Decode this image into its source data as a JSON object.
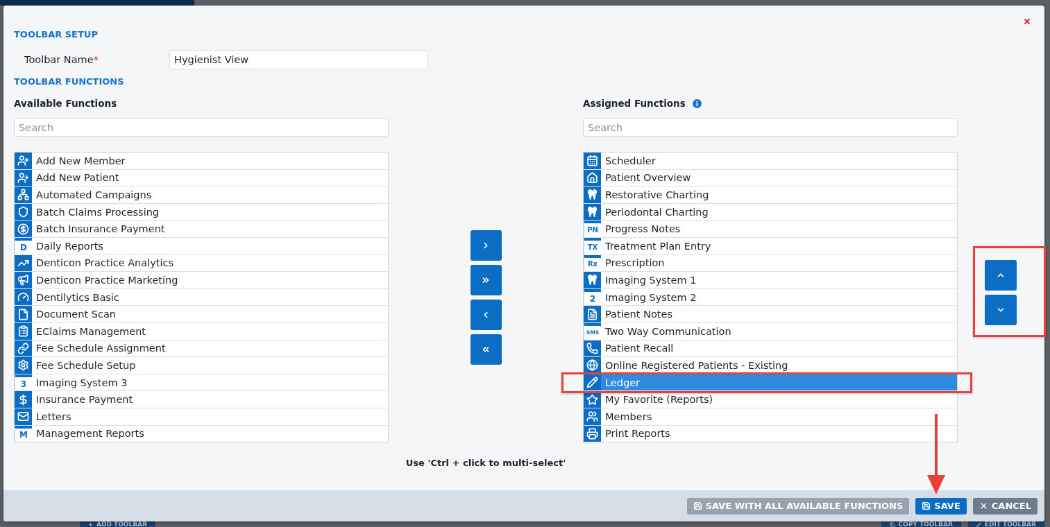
{
  "dialog": {
    "title": "TOOLBAR SETUP",
    "name_field": {
      "label": "Toolbar Name",
      "required_mark": "*",
      "value": "Hygienist View"
    },
    "functions_title": "TOOLBAR FUNCTIONS"
  },
  "available": {
    "title": "Available Functions",
    "search_placeholder": "Search",
    "items": [
      {
        "label": "Add New Member",
        "selected": false
      },
      {
        "label": "Add New Patient",
        "selected": false
      },
      {
        "label": "Automated Campaigns",
        "selected": false
      },
      {
        "label": "Batch Claims Processing",
        "selected": false
      },
      {
        "label": "Batch Insurance Payment",
        "selected": false
      },
      {
        "label": "Daily Reports",
        "icon_text": "D",
        "selected": false
      },
      {
        "label": "Denticon Practice Analytics",
        "selected": false
      },
      {
        "label": "Denticon Practice Marketing",
        "selected": false
      },
      {
        "label": "Dentilytics Basic",
        "selected": false
      },
      {
        "label": "Document Scan",
        "selected": false
      },
      {
        "label": "EClaims Management",
        "selected": false
      },
      {
        "label": "Fee Schedule Assignment",
        "selected": false
      },
      {
        "label": "Fee Schedule Setup",
        "selected": false
      },
      {
        "label": "Imaging System 3",
        "icon_text": "3",
        "selected": false
      },
      {
        "label": "Insurance Payment",
        "selected": false
      },
      {
        "label": "Letters",
        "selected": false
      },
      {
        "label": "Management Reports",
        "icon_text": "M",
        "selected": false
      }
    ]
  },
  "transfer_buttons": [
    {
      "kind": "add"
    },
    {
      "kind": "add_all"
    },
    {
      "kind": "remove"
    },
    {
      "kind": "remove_all"
    }
  ],
  "assigned": {
    "title": "Assigned Functions",
    "info": true,
    "search_placeholder": "Search",
    "items": [
      {
        "label": "Scheduler",
        "selected": false,
        "highlighted": false
      },
      {
        "label": "Patient Overview",
        "selected": false,
        "highlighted": false
      },
      {
        "label": "Restorative Charting",
        "selected": false,
        "highlighted": false
      },
      {
        "label": "Periodontal Charting",
        "selected": false,
        "highlighted": false
      },
      {
        "label": "Progress Notes",
        "icon_text": "PN",
        "selected": false,
        "highlighted": false
      },
      {
        "label": "Treatment Plan Entry",
        "icon_text": "TX",
        "selected": false,
        "highlighted": false
      },
      {
        "label": "Prescription",
        "icon_text": "Rx",
        "selected": false,
        "highlighted": false
      },
      {
        "label": "Imaging System 1",
        "selected": false,
        "highlighted": false
      },
      {
        "label": "Imaging System 2",
        "icon_text": "2",
        "selected": false,
        "highlighted": false
      },
      {
        "label": "Patient Notes",
        "selected": false,
        "highlighted": false
      },
      {
        "label": "Two Way Communication",
        "icon_text": "SMS",
        "selected": false,
        "highlighted": false
      },
      {
        "label": "Patient Recall",
        "selected": false,
        "highlighted": false
      },
      {
        "label": "Online Registered Patients - Existing",
        "selected": false,
        "highlighted": false
      },
      {
        "label": "Ledger",
        "selected": true,
        "highlighted": true
      },
      {
        "label": "My Favorite (Reports)",
        "selected": false,
        "highlighted": false
      },
      {
        "label": "Members",
        "selected": false,
        "highlighted": false
      },
      {
        "label": "Print Reports",
        "selected": false,
        "highlighted": false
      }
    ]
  },
  "order_buttons": {
    "highlighted": true,
    "buttons": [
      {
        "kind": "up"
      },
      {
        "kind": "down"
      }
    ]
  },
  "hint": "Use 'Ctrl + click to multi-select'",
  "footer_buttons": [
    {
      "kind": "save_all",
      "label": "SAVE WITH ALL AVAILABLE FUNCTIONS",
      "disabled": true,
      "highlighted": false
    },
    {
      "kind": "save",
      "label": "SAVE",
      "disabled": false,
      "highlighted": true
    },
    {
      "kind": "cancel",
      "label": "CANCEL",
      "disabled": false,
      "highlighted": false
    }
  ],
  "background_buttons": [
    {
      "kind": "add",
      "label": "ADD TOOLBAR"
    },
    {
      "kind": "copy",
      "label": "COPY TOOLBAR"
    },
    {
      "kind": "edit",
      "label": "EDIT TOOLBAR"
    }
  ]
}
